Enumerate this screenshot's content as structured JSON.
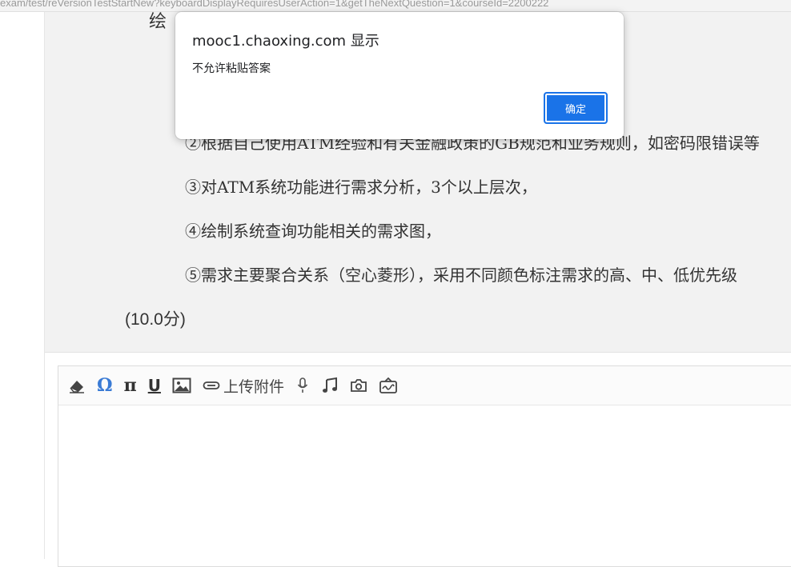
{
  "browser": {
    "url_fragment": "exam/test/reVersionTestStartNew?keyboardDisplayRequiresUserAction=1&getTheNextQuestion=1&courseId=2200222"
  },
  "question": {
    "top_fragment": "绘",
    "line2": "②根据自己使用ATM经验和有关金融政策的GB规范和业务规则，如密码限错误等",
    "line3": "③对ATM系统功能进行需求分析，3个以上层次，",
    "line4": "④绘制系统查询功能相关的需求图，",
    "line5": "⑤需求主要聚合关系（空心菱形），采用不同颜色标注需求的高、中、低优先级",
    "score": "(10.0分)"
  },
  "editor": {
    "upload_label": "上传附件",
    "toolbar_icons": [
      "eraser-icon",
      "omega-icon",
      "pi-icon",
      "underline-icon",
      "image-icon",
      "attachment-icon",
      "microphone-icon",
      "music-icon",
      "camera-icon",
      "handwriting-icon"
    ]
  },
  "dialog": {
    "title": "mooc1.chaoxing.com 显示",
    "message": "不允许粘贴答案",
    "ok_label": "确定"
  },
  "colors": {
    "accent": "#1a73e8",
    "omega_blue": "#3a7bd5",
    "question_bg": "#f2f2f2"
  }
}
